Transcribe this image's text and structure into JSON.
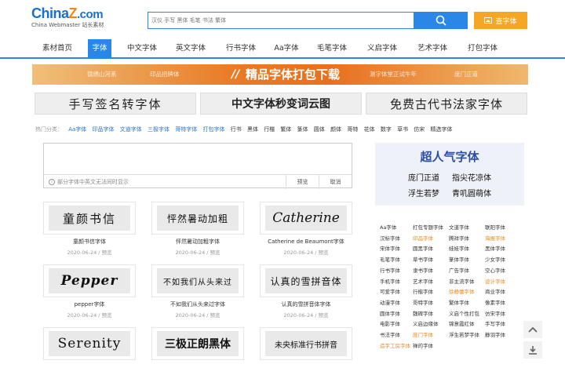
{
  "header": {
    "logo_brand_a": "China",
    "logo_brand_z": "Z",
    "logo_brand_b": ".com",
    "logo_sub": "China Webmaster 站长素材",
    "search_placeholder": "汉仪 手写 黑体 毛笔 书法 繁体",
    "find_font_label": "查字体"
  },
  "nav": {
    "items": [
      "素材首页",
      "字体",
      "中文字体",
      "英文字体",
      "行书字体",
      "Aa字体",
      "毛笔字体",
      "义启字体",
      "艺术字体",
      "打包字体"
    ],
    "active_index": 1
  },
  "banner": {
    "left_a": "锦绣山河系",
    "left_b": "印品招牌体",
    "slash": "//",
    "main": "精品字体打包下载",
    "right_a": "测字体堂正试牛年",
    "right_b": "庞门正道"
  },
  "tiles": [
    "手写签名转字体",
    "中文字体秒变词云图",
    "免费古代书法家字体"
  ],
  "hot": {
    "label": "热门分类：",
    "items_blue": [
      "Aa字体",
      "印品字体",
      "文道字体",
      "三极字体",
      "哥特字体",
      "打包字体"
    ],
    "items": [
      "行书",
      "黑体",
      "行楷",
      "繁体",
      "篆体",
      "圆体",
      "颜体",
      "哥特",
      "花体",
      "数字",
      "草书",
      "仿宋",
      "精选字体"
    ]
  },
  "editor": {
    "hint": "部分字体中英文无法同时显示",
    "preview_label": "预览",
    "cancel_label": "取消"
  },
  "cards": [
    {
      "preview": "童颜书信",
      "name": "童颜书信字体",
      "date": "2020-06-24",
      "action": "预览"
    },
    {
      "preview": "怦然暑动加粗",
      "name": "怦然暑动加粗字体",
      "date": "2020-06-24",
      "action": "预览"
    },
    {
      "preview": "Catherine",
      "name": "Catherine de Beaumont字体",
      "date": "2020-06-24",
      "action": "预览"
    },
    {
      "preview": "Pepper",
      "name": "pepper字体",
      "date": "2020-06-24",
      "action": "预览"
    },
    {
      "preview": "不如我们从头来过",
      "name": "不如我们从头来过字体",
      "date": "2020-06-24",
      "action": "预览"
    },
    {
      "preview": "认真的雪拼音体",
      "name": "认真的雪拼音体字体",
      "date": "2020-06-24",
      "action": "预览"
    },
    {
      "preview": "Serenity",
      "name": "",
      "date": "",
      "action": ""
    },
    {
      "preview": "三极正朗黑体",
      "name": "",
      "date": "",
      "action": ""
    },
    {
      "preview": "未央标准行书拼音",
      "name": "",
      "date": "",
      "action": ""
    }
  ],
  "promo": {
    "title": "超人气字体",
    "row1": [
      "庞门正道",
      "指尖花凉体"
    ],
    "row2": [
      "浮生若梦",
      "青叽圆萌体"
    ]
  },
  "tags": [
    [
      "Aa字体",
      "打包专题字体",
      "文道字体",
      "联阳字体"
    ],
    [
      "汉标字体",
      "印品字体",
      "腾祥字体",
      "海报字体"
    ],
    [
      "宋体字体",
      "圆黑字体",
      "娃娃字体",
      "黑体字体"
    ],
    [
      "毛笔字体",
      "草书字体",
      "篆体字体",
      "少女字体"
    ],
    [
      "行书字体",
      "隶书字体",
      "广告字体",
      "空心字体"
    ],
    [
      "手机字体",
      "艺术字体",
      "非主流字体",
      "设计字体"
    ],
    [
      "可爱字体",
      "行楷字体",
      "徐静蕾字体",
      "商业字体"
    ],
    [
      "动漫字体",
      "哥特字体",
      "繁体字体",
      "像素字体"
    ],
    [
      "圆体字体",
      "魏碑字体",
      "义启个性打包",
      "仿宋字体"
    ],
    [
      "电影字体",
      "义启边缘体",
      "锦意霞红体",
      "手写字体"
    ],
    [
      "书法字体",
      "庞门字体",
      "浮生若梦字体",
      "静羽字体"
    ],
    [
      "造字工房字体",
      "禅的字体",
      "",
      ""
    ]
  ],
  "tags_orange": [
    "印品字体",
    "海报字体",
    "设计字体",
    "徐静蕾字体",
    "庞门字体",
    "造字工房字体"
  ],
  "colors": {
    "brand_blue": "#2a87e8",
    "accent_orange": "#f5a623"
  }
}
